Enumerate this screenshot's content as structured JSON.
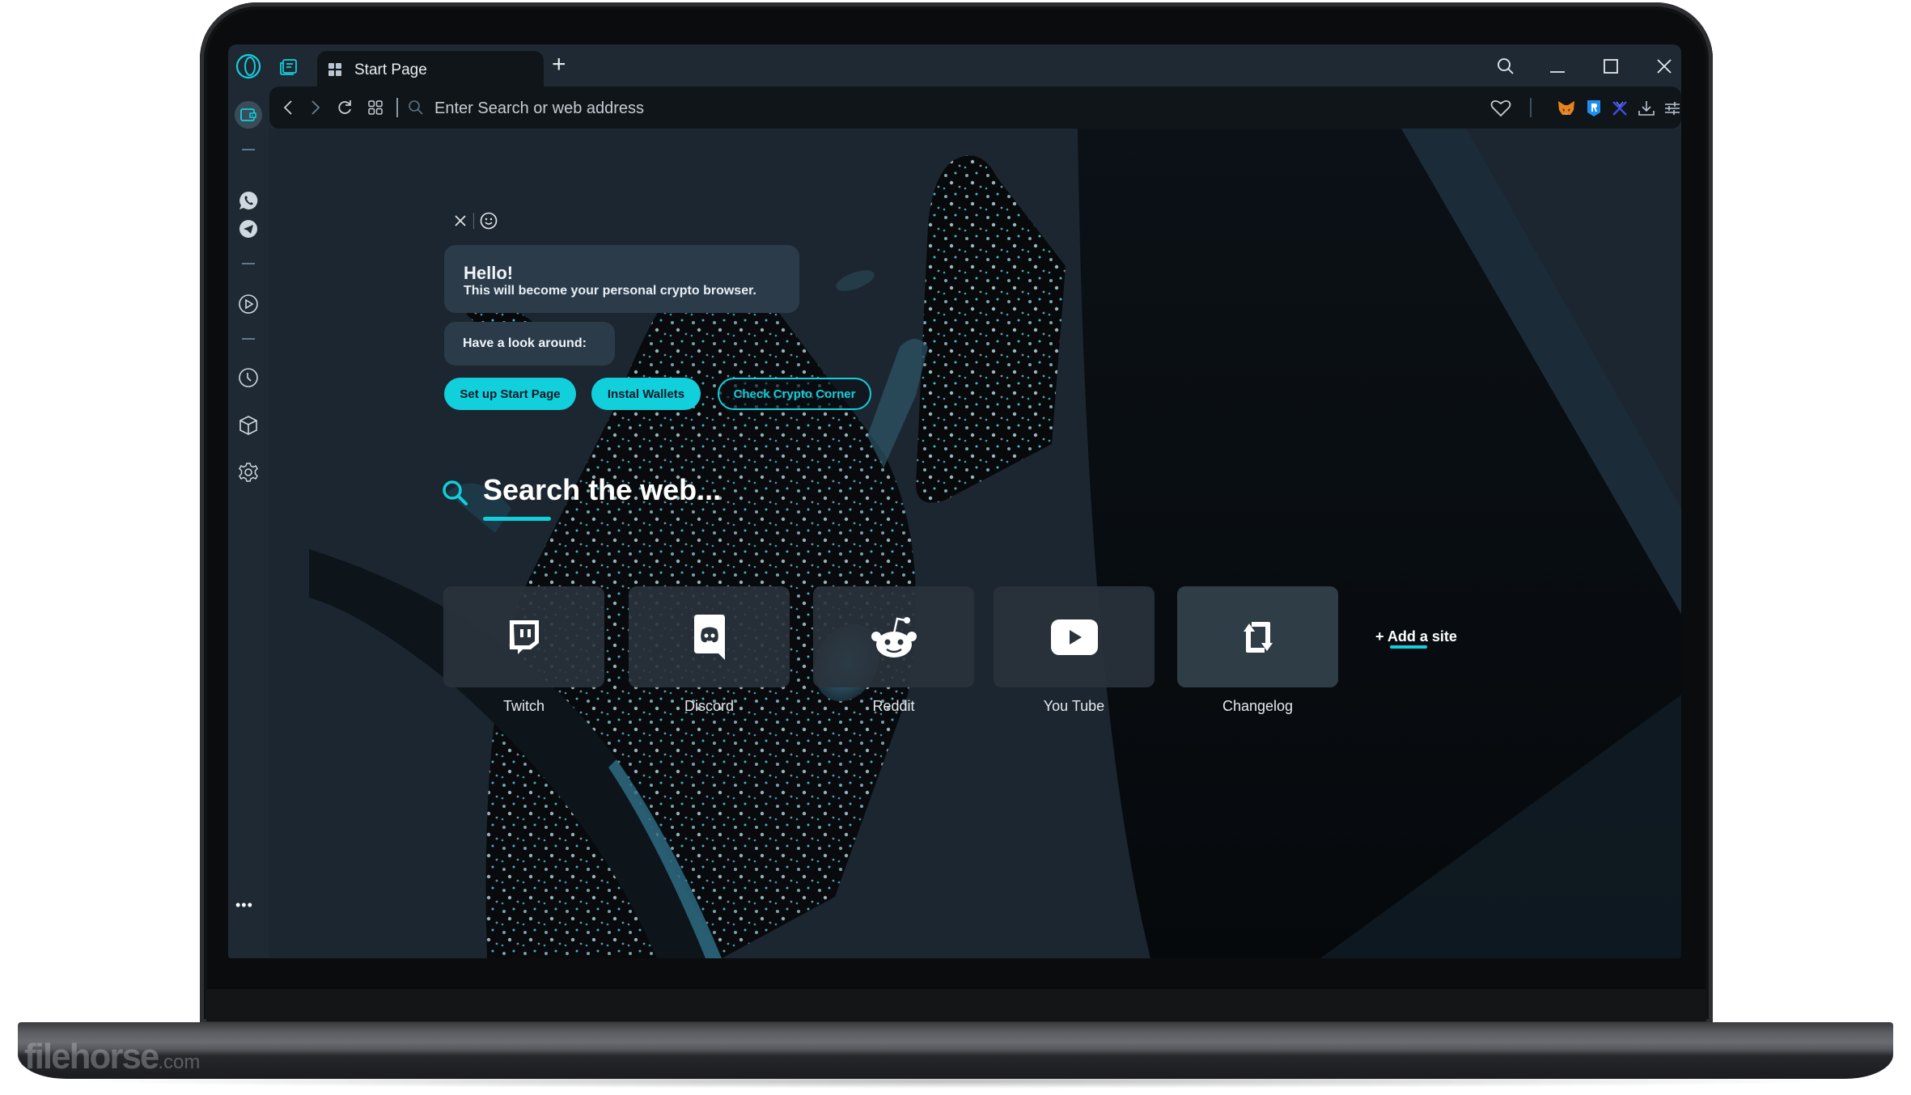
{
  "browser": {
    "tabs": [
      {
        "label": "Start Page",
        "icon": "grid-icon",
        "active": true
      }
    ],
    "new_tab_label": "+",
    "address_bar": {
      "placeholder": "Enter Search or web address",
      "value": ""
    },
    "toolbar_icons": [
      "back-icon",
      "forward-icon",
      "reload-icon",
      "tab-grid-icon",
      "search-icon",
      "heart-icon",
      "metamask-icon",
      "wallet-r-icon",
      "exchange-x-icon",
      "download-icon",
      "settings-sliders-icon"
    ],
    "window_controls": [
      "search-icon",
      "minimize-icon",
      "maximize-icon",
      "close-icon"
    ]
  },
  "sidebar": {
    "items": [
      {
        "name": "wallet",
        "icon": "wallet-icon",
        "active": true
      },
      {
        "name": "whatsapp",
        "icon": "whatsapp-icon"
      },
      {
        "name": "telegram",
        "icon": "telegram-icon"
      },
      {
        "name": "player",
        "icon": "play-icon"
      },
      {
        "name": "history",
        "icon": "clock-icon"
      },
      {
        "name": "extensions",
        "icon": "cube-icon"
      },
      {
        "name": "settings",
        "icon": "gear-icon"
      }
    ],
    "more_label": "•••"
  },
  "assistant": {
    "greeting_title": "Hello!",
    "greeting_text": "This will become your personal crypto browser.",
    "prompt": "Have a look around:",
    "buttons": [
      {
        "label": "Set up Start Page",
        "style": "filled"
      },
      {
        "label": "Instal Wallets",
        "style": "filled"
      },
      {
        "label": "Check Crypto Corner",
        "style": "outline"
      }
    ]
  },
  "search": {
    "label": "Search the web..."
  },
  "speed_dial": {
    "sites": [
      {
        "label": "Twitch",
        "icon": "twitch-icon"
      },
      {
        "label": "Discord",
        "icon": "discord-icon"
      },
      {
        "label": "Reddit",
        "icon": "reddit-icon"
      },
      {
        "label": "You Tube",
        "icon": "youtube-icon"
      },
      {
        "label": "Changelog",
        "icon": "changelog-icon"
      }
    ],
    "add_site_label": "+ Add a site"
  },
  "watermark": {
    "text": "filehorse",
    "suffix": ".com"
  },
  "colors": {
    "accent": "#12cfdc",
    "chrome": "#1f2933",
    "address_bar": "#101519",
    "card": "#2b3b4a"
  }
}
